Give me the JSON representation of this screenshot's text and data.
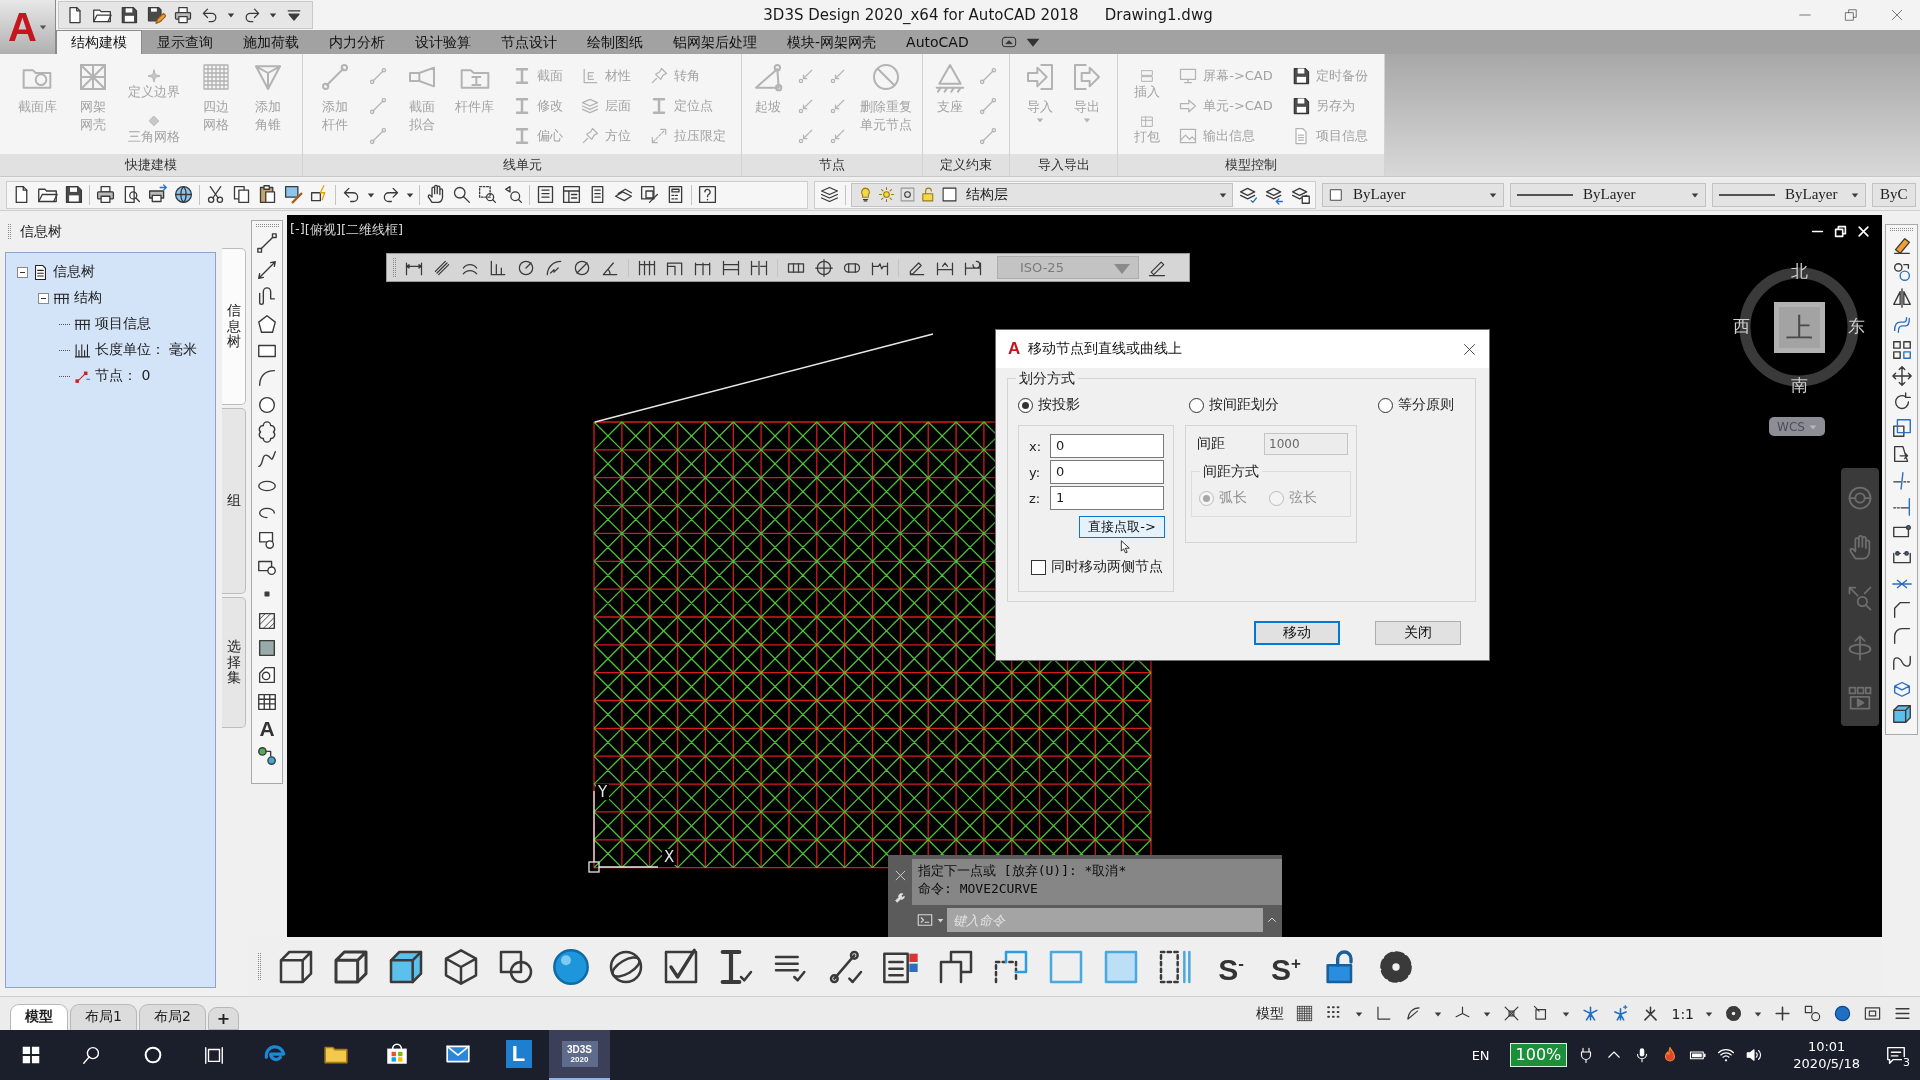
{
  "app_menu": {
    "logo": "A"
  },
  "title_bar": {
    "title": "3D3S Design 2020_x64 for AutoCAD 2018",
    "file": "Drawing1.dwg"
  },
  "ribbon_tabs": [
    {
      "label": "结构建模",
      "selected": true
    },
    {
      "label": "显示查询",
      "selected": false
    },
    {
      "label": "施加荷载",
      "selected": false
    },
    {
      "label": "内力分析",
      "selected": false
    },
    {
      "label": "设计验算",
      "selected": false
    },
    {
      "label": "节点设计",
      "selected": false
    },
    {
      "label": "绘制图纸",
      "selected": false
    },
    {
      "label": "铝网架后处理",
      "selected": false
    },
    {
      "label": "模块-网架网壳",
      "selected": false
    },
    {
      "label": "AutoCAD",
      "selected": false
    }
  ],
  "ribbon": {
    "disabled": true,
    "panels": [
      {
        "title": "快捷建模",
        "items": [
          {
            "kind": "large",
            "lines": [
              "截面库"
            ]
          },
          {
            "kind": "large",
            "lines": [
              "网架",
              "网壳"
            ]
          },
          {
            "kind": "medium",
            "label": "定义边界"
          },
          {
            "kind": "medium",
            "label": "三角网格"
          },
          {
            "kind": "large",
            "lines": [
              "四边",
              "网格"
            ]
          },
          {
            "kind": "large",
            "lines": [
              "添加",
              "角锥"
            ]
          }
        ]
      },
      {
        "title": "线单元",
        "items": [
          {
            "kind": "large",
            "lines": [
              "添加",
              "杆件"
            ]
          },
          {
            "kind": "small_icon"
          },
          {
            "kind": "small_icon"
          },
          {
            "kind": "small_icon"
          },
          {
            "kind": "large",
            "lines": [
              "截面",
              "拟合"
            ]
          },
          {
            "kind": "large",
            "lines": [
              "杆件库"
            ]
          },
          {
            "kind": "small",
            "label": "截面"
          },
          {
            "kind": "small",
            "label": "修改"
          },
          {
            "kind": "small",
            "label": "偏心"
          },
          {
            "kind": "small",
            "label": "材性"
          },
          {
            "kind": "small",
            "label": "层面"
          },
          {
            "kind": "small",
            "label": "方位"
          },
          {
            "kind": "small",
            "label": "转角"
          },
          {
            "kind": "small",
            "label": "定位点"
          },
          {
            "kind": "small",
            "label": "拉压限定"
          }
        ]
      },
      {
        "title": "节点",
        "items": [
          {
            "kind": "large",
            "lines": [
              "起坡"
            ]
          },
          {
            "kind": "small_icon"
          },
          {
            "kind": "small_icon"
          },
          {
            "kind": "small_icon"
          },
          {
            "kind": "small_icon"
          },
          {
            "kind": "small_icon"
          },
          {
            "kind": "small_icon"
          },
          {
            "kind": "large",
            "lines": [
              "删除重复",
              "单元节点"
            ]
          }
        ]
      },
      {
        "title": "定义约束",
        "items": [
          {
            "kind": "large",
            "lines": [
              "支座"
            ]
          },
          {
            "kind": "small_icon"
          },
          {
            "kind": "small_icon"
          },
          {
            "kind": "small_icon"
          }
        ]
      },
      {
        "title": "导入导出",
        "items": [
          {
            "kind": "large_menu",
            "lines": [
              "导入"
            ]
          },
          {
            "kind": "large_menu",
            "lines": [
              "导出"
            ]
          }
        ]
      },
      {
        "title": "模型控制",
        "items": [
          {
            "kind": "medium",
            "label": "插入"
          },
          {
            "kind": "medium",
            "label": "打包"
          },
          {
            "kind": "small",
            "label": "屏幕->CAD"
          },
          {
            "kind": "small",
            "label": "单元->CAD"
          },
          {
            "kind": "small",
            "label": "输出信息"
          },
          {
            "kind": "small",
            "label": "定时备份"
          },
          {
            "kind": "small",
            "label": "另存为"
          },
          {
            "kind": "small",
            "label": "项目信息"
          }
        ]
      }
    ]
  },
  "toolbar": {
    "layer": "结构层",
    "properties": [
      {
        "kind": "color",
        "value": "ByLayer"
      },
      {
        "kind": "linetype",
        "value": "ByLayer"
      },
      {
        "kind": "lineweight",
        "value": "ByLayer"
      },
      {
        "kind": "plot_style",
        "value": "ByC"
      }
    ]
  },
  "palette": {
    "title": "信息树",
    "tree": [
      {
        "label": "信息树",
        "kind": "document",
        "expanded": true,
        "children": [
          {
            "label": "结构",
            "kind": "frame",
            "expanded": true,
            "children": [
              {
                "label": "项目信息",
                "kind": "frame"
              },
              {
                "label": "长度单位： 毫米",
                "kind": "ruler"
              },
              {
                "label": "节点： 0",
                "kind": "nodes"
              }
            ]
          }
        ]
      }
    ],
    "tabs": [
      {
        "label": "信息树",
        "selected": true
      },
      {
        "label": "组",
        "selected": false
      },
      {
        "label": "选择集",
        "selected": false
      }
    ]
  },
  "draw_toolbar": {
    "text_tool": "A"
  },
  "viewport": {
    "controls": [
      "[-]",
      "[俯视]",
      "[二维线框]"
    ],
    "dim_style": "ISO-25",
    "viewcube": {
      "north": "北",
      "west": "西",
      "east": "东",
      "south": "南",
      "face": "上",
      "ucs": "WCS"
    },
    "ucs_axes": {
      "x": "X",
      "y": "Y"
    }
  },
  "dialog": {
    "icon": "A",
    "title": "移动节点到直线或曲线上",
    "group_title": "划分方式",
    "modes": [
      {
        "label": "按投影",
        "selected": true
      },
      {
        "label": "按间距划分",
        "selected": false
      },
      {
        "label": "等分原则",
        "selected": false
      }
    ],
    "coords": [
      {
        "label": "x:",
        "value": "0"
      },
      {
        "label": "y:",
        "value": "0"
      },
      {
        "label": "z:",
        "value": "1"
      }
    ],
    "pick_button": "直接点取->",
    "move_both": {
      "label": "同时移动两侧节点",
      "checked": false
    },
    "spacing": {
      "label": "间距",
      "value": "1000",
      "disabled": true
    },
    "spacing_mode": {
      "title": "间距方式",
      "disabled": true,
      "options": [
        {
          "label": "弧长",
          "selected": true
        },
        {
          "label": "弦长",
          "selected": false
        }
      ]
    },
    "buttons": [
      {
        "label": "移动",
        "default": true
      },
      {
        "label": "关闭",
        "default": false
      }
    ]
  },
  "command_line": {
    "history": [
      "指定下一点或 [放弃(U)]: *取消*",
      "命令: MOVE2CURVE"
    ],
    "placeholder": "键入命令"
  },
  "bottom_toolbar": {
    "text_tools": [
      "S$^{-}$",
      "S$^{+}$"
    ]
  },
  "layout_tabs": [
    {
      "label": "模型",
      "selected": true
    },
    {
      "label": "布局1",
      "selected": false
    },
    {
      "label": "布局2",
      "selected": false
    }
  ],
  "add_layout": "+",
  "status_bar": {
    "space": "模型",
    "scale": "1:1"
  },
  "taskbar": {
    "apps": [
      {
        "kind": "browser",
        "active": false
      },
      {
        "kind": "files",
        "active": false
      },
      {
        "kind": "store",
        "active": false
      },
      {
        "kind": "mail",
        "active": false
      },
      {
        "kind": "letter",
        "label": "L",
        "active": false
      },
      {
        "kind": "tile",
        "label": "3D3S",
        "sublabel": "2020",
        "active": true
      }
    ],
    "language": "EN",
    "badge": "100%",
    "time": "10:01",
    "date": "2020/5/18",
    "notifications": "3"
  }
}
